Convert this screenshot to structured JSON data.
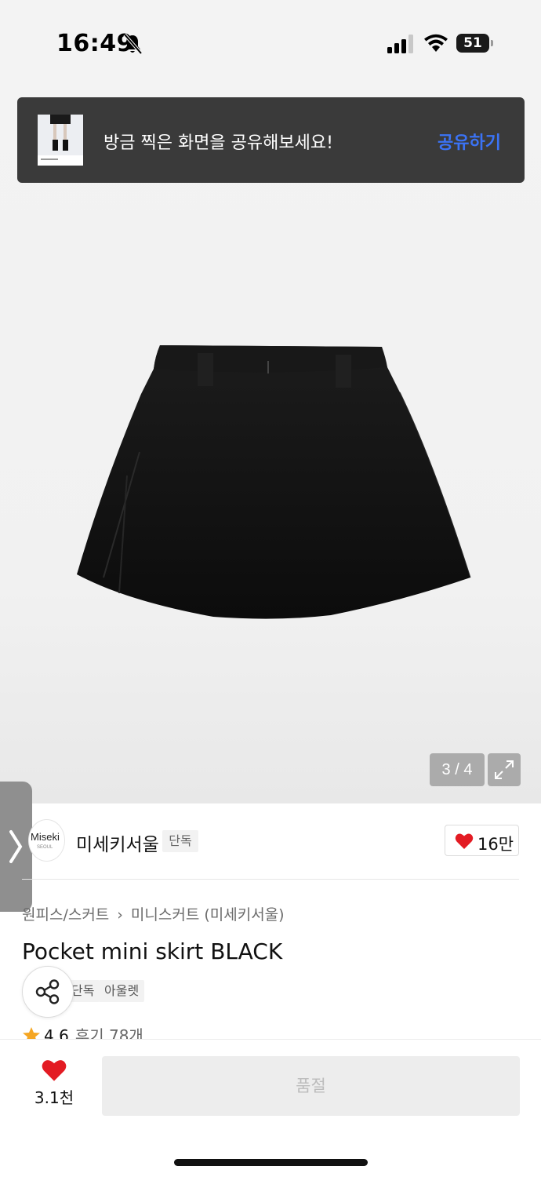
{
  "status_bar": {
    "time": "16:49",
    "battery": "51"
  },
  "toast": {
    "message": "방금 찍은 화면을 공유해보세요!",
    "action": "공유하기"
  },
  "gallery": {
    "counter": "3 / 4"
  },
  "brand": {
    "logo_text": "Miseki",
    "logo_sub": "SEOUL",
    "name": "미세키서울",
    "badge": "단독",
    "likes": "16만",
    "accent": "#e31b23"
  },
  "breadcrumb": {
    "category": "원피스/스커트",
    "subcategory": "미니스커트 (미세키서울)"
  },
  "product": {
    "title": "Pocket mini skirt BLACK",
    "tags": [
      "단독",
      "아울렛"
    ],
    "rating": "4.6",
    "reviews": "후기 78개"
  },
  "bottom_bar": {
    "wish_count": "3.1천",
    "purchase_label": "품절"
  }
}
